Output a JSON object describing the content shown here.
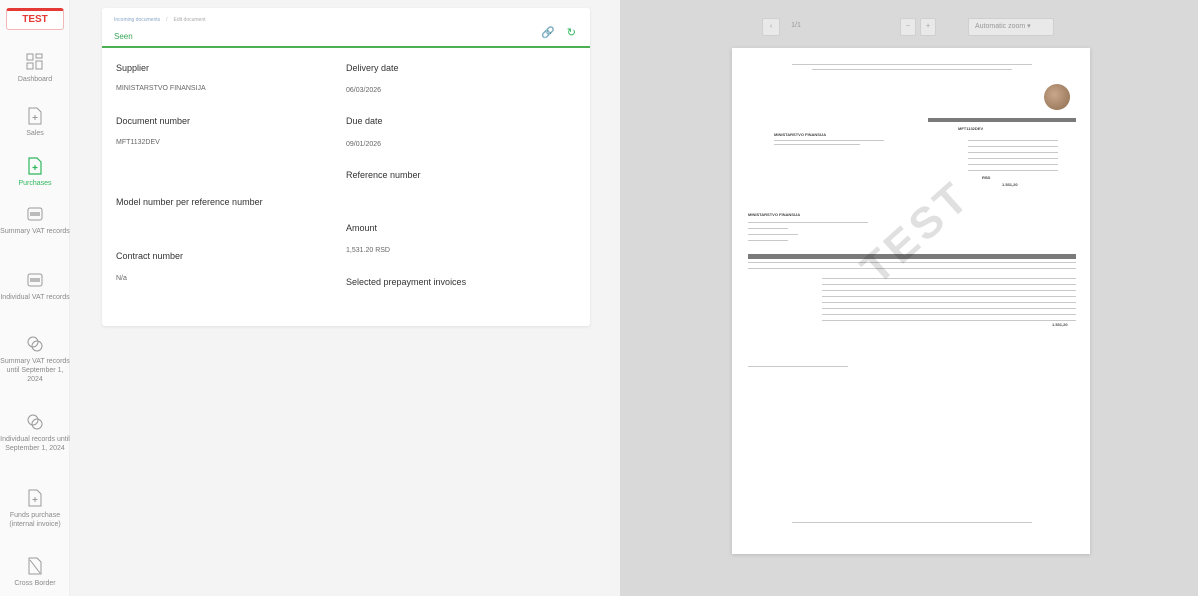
{
  "sidebar": {
    "brand": "TEST",
    "items": [
      {
        "label": "Dashboard",
        "icon": "dashboard-icon"
      },
      {
        "label": "Sales",
        "icon": "sales-document-icon"
      },
      {
        "label": "Purchases",
        "icon": "purchases-document-icon",
        "active": true
      },
      {
        "label": "Summary VAT records",
        "icon": "summary-vat-icon"
      },
      {
        "label": "Individual VAT records",
        "icon": "individual-vat-icon"
      },
      {
        "label": "Summary VAT records until September 1, 2024",
        "icon": "summary-vat-legacy-icon"
      },
      {
        "label": "Individual records until September 1, 2024",
        "icon": "individual-vat-legacy-icon"
      },
      {
        "label": "Funds purchase (internal invoice)",
        "icon": "funds-purchase-icon"
      },
      {
        "label": "Cross Border",
        "icon": "cross-border-icon"
      }
    ]
  },
  "card": {
    "breadcrumb": [
      "Incoming documents",
      "Edit document"
    ],
    "status": "Seen",
    "fields": {
      "supplier_label": "Supplier",
      "supplier_value": "MINISTARSTVO FINANSIJA",
      "delivery_label": "Delivery date",
      "delivery_value": "06/03/2026",
      "docnum_label": "Document number",
      "docnum_value": "MFT1132DEV",
      "due_label": "Due date",
      "due_value": "09/01/2026",
      "refnum_label": "Reference number",
      "model_label": "Model number per reference number",
      "amount_label": "Amount",
      "amount_value": "1,531.20 RSD",
      "contract_label": "Contract number",
      "contract_value": "N/a",
      "prepay_label": "Selected prepayment invoices"
    }
  },
  "viewer": {
    "page_indicator": "1/1",
    "zoom_out": "−",
    "zoom_in": "+",
    "zoom_select": "Automatic zoom",
    "watermark": "TEST",
    "doc": {
      "supplier_name": "MINISTARSTVO FINANSIJA",
      "invoice_no": "MFT1132DEV",
      "buyer_name": "MINISTARSTVO FINANSIJA",
      "total": "1.531,20",
      "currency": "RSD"
    }
  },
  "colors": {
    "accent_green": "#2eb85c",
    "brand_red": "#e53935"
  }
}
